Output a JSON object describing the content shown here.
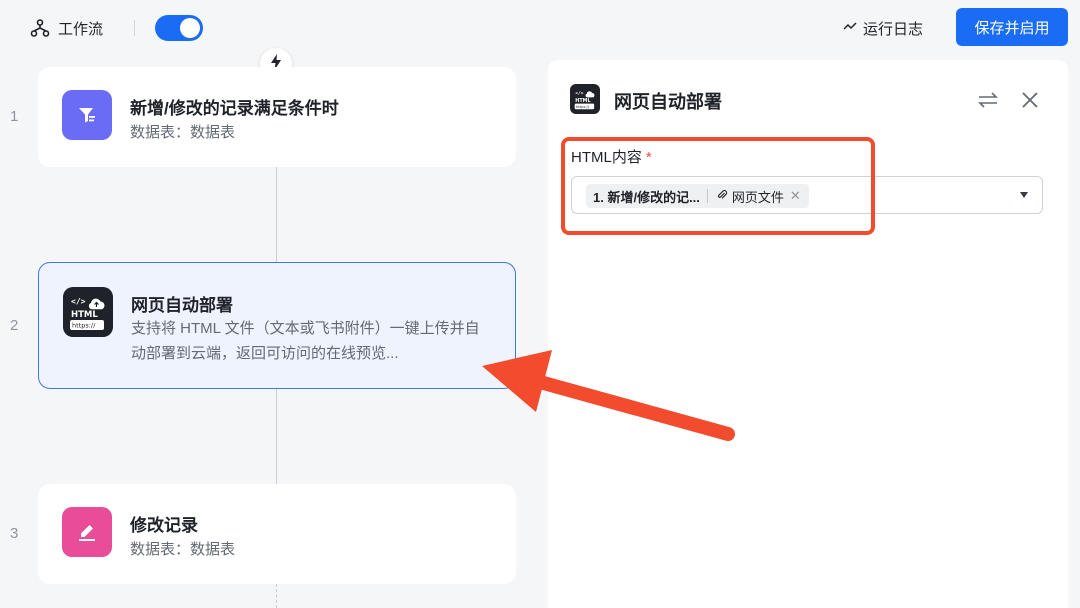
{
  "topbar": {
    "title": "工作流",
    "toggle_on": true,
    "run_log_label": "运行日志",
    "save_button_label": "保存并启用"
  },
  "steps": [
    {
      "number": "1",
      "title": "新增/修改的记录满足条件时",
      "subtitle": "数据表：数据表",
      "icon": "filter-icon",
      "icon_color": "#6b6cf6"
    },
    {
      "number": "2",
      "title": "网页自动部署",
      "description": "支持将 HTML 文件（文本或飞书附件）一键上传并自动部署到云端，返回可访问的在线预览...",
      "icon": "html-deploy-icon",
      "icon_color": "#1f2329",
      "selected": true
    },
    {
      "number": "3",
      "title": "修改记录",
      "subtitle": "数据表：数据表",
      "icon": "edit-icon",
      "icon_color": "#e94d9a"
    }
  ],
  "panel": {
    "title": "网页自动部署",
    "field": {
      "label": "HTML内容",
      "required_mark": "*",
      "chip_ref": "1. 新增/修改的记...",
      "chip_field": "网页文件"
    }
  },
  "colors": {
    "accent": "#1a6cf5",
    "annotation": "#f24b2e",
    "selected_border": "#3f77e6"
  }
}
